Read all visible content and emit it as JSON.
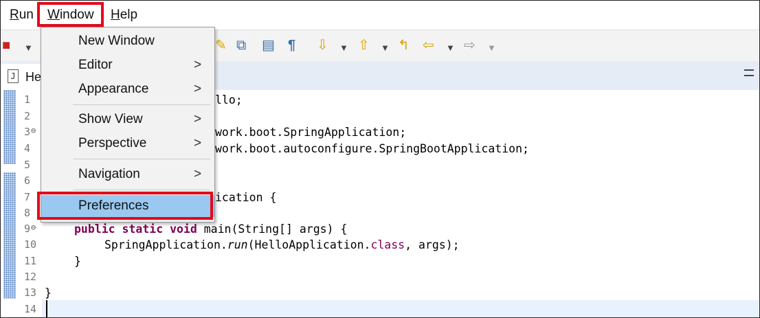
{
  "menubar": {
    "run": "Run",
    "window_prefix": "",
    "window_mnemonic": "W",
    "window_rest": "indow",
    "help_mnemonic": "H",
    "help_rest": "elp"
  },
  "tab": {
    "icon_glyph": "J",
    "label": "He"
  },
  "window_menu": {
    "items": [
      {
        "label": "New Window",
        "submenu": false
      },
      {
        "label": "Editor",
        "submenu": true
      },
      {
        "label": "Appearance",
        "submenu": true
      },
      {
        "label": "Show View",
        "submenu": true
      },
      {
        "label": "Perspective",
        "submenu": true
      },
      {
        "label": "Navigation",
        "submenu": true
      },
      {
        "label": "Preferences",
        "submenu": false,
        "selected": true
      }
    ],
    "arrow_glyph": ">"
  },
  "editor": {
    "line_numbers": [
      "1",
      "2",
      "3",
      "4",
      "5",
      "6",
      "7",
      "8",
      "9",
      "10",
      "11",
      "12",
      "13",
      "14"
    ],
    "fold_glyph": "⊖",
    "lines": {
      "l1": "llo;",
      "l3": "work.boot.SpringApplication;",
      "l4": "work.boot.autoconfigure.SpringBootApplication;",
      "l7": "ication {",
      "l9_kw": "public static void",
      "l9_rest": " main(String[] args) {",
      "l10_a": "SpringApplication.",
      "l10_run": "run",
      "l10_b": "(HelloApplication.",
      "l10_class": "class",
      "l10_c": ", args);",
      "l11": "}",
      "l13": "}"
    }
  },
  "colors": {
    "highlight_red": "#e4081b",
    "selected_item": "#99c9f0",
    "keyword": "#7f0055"
  }
}
